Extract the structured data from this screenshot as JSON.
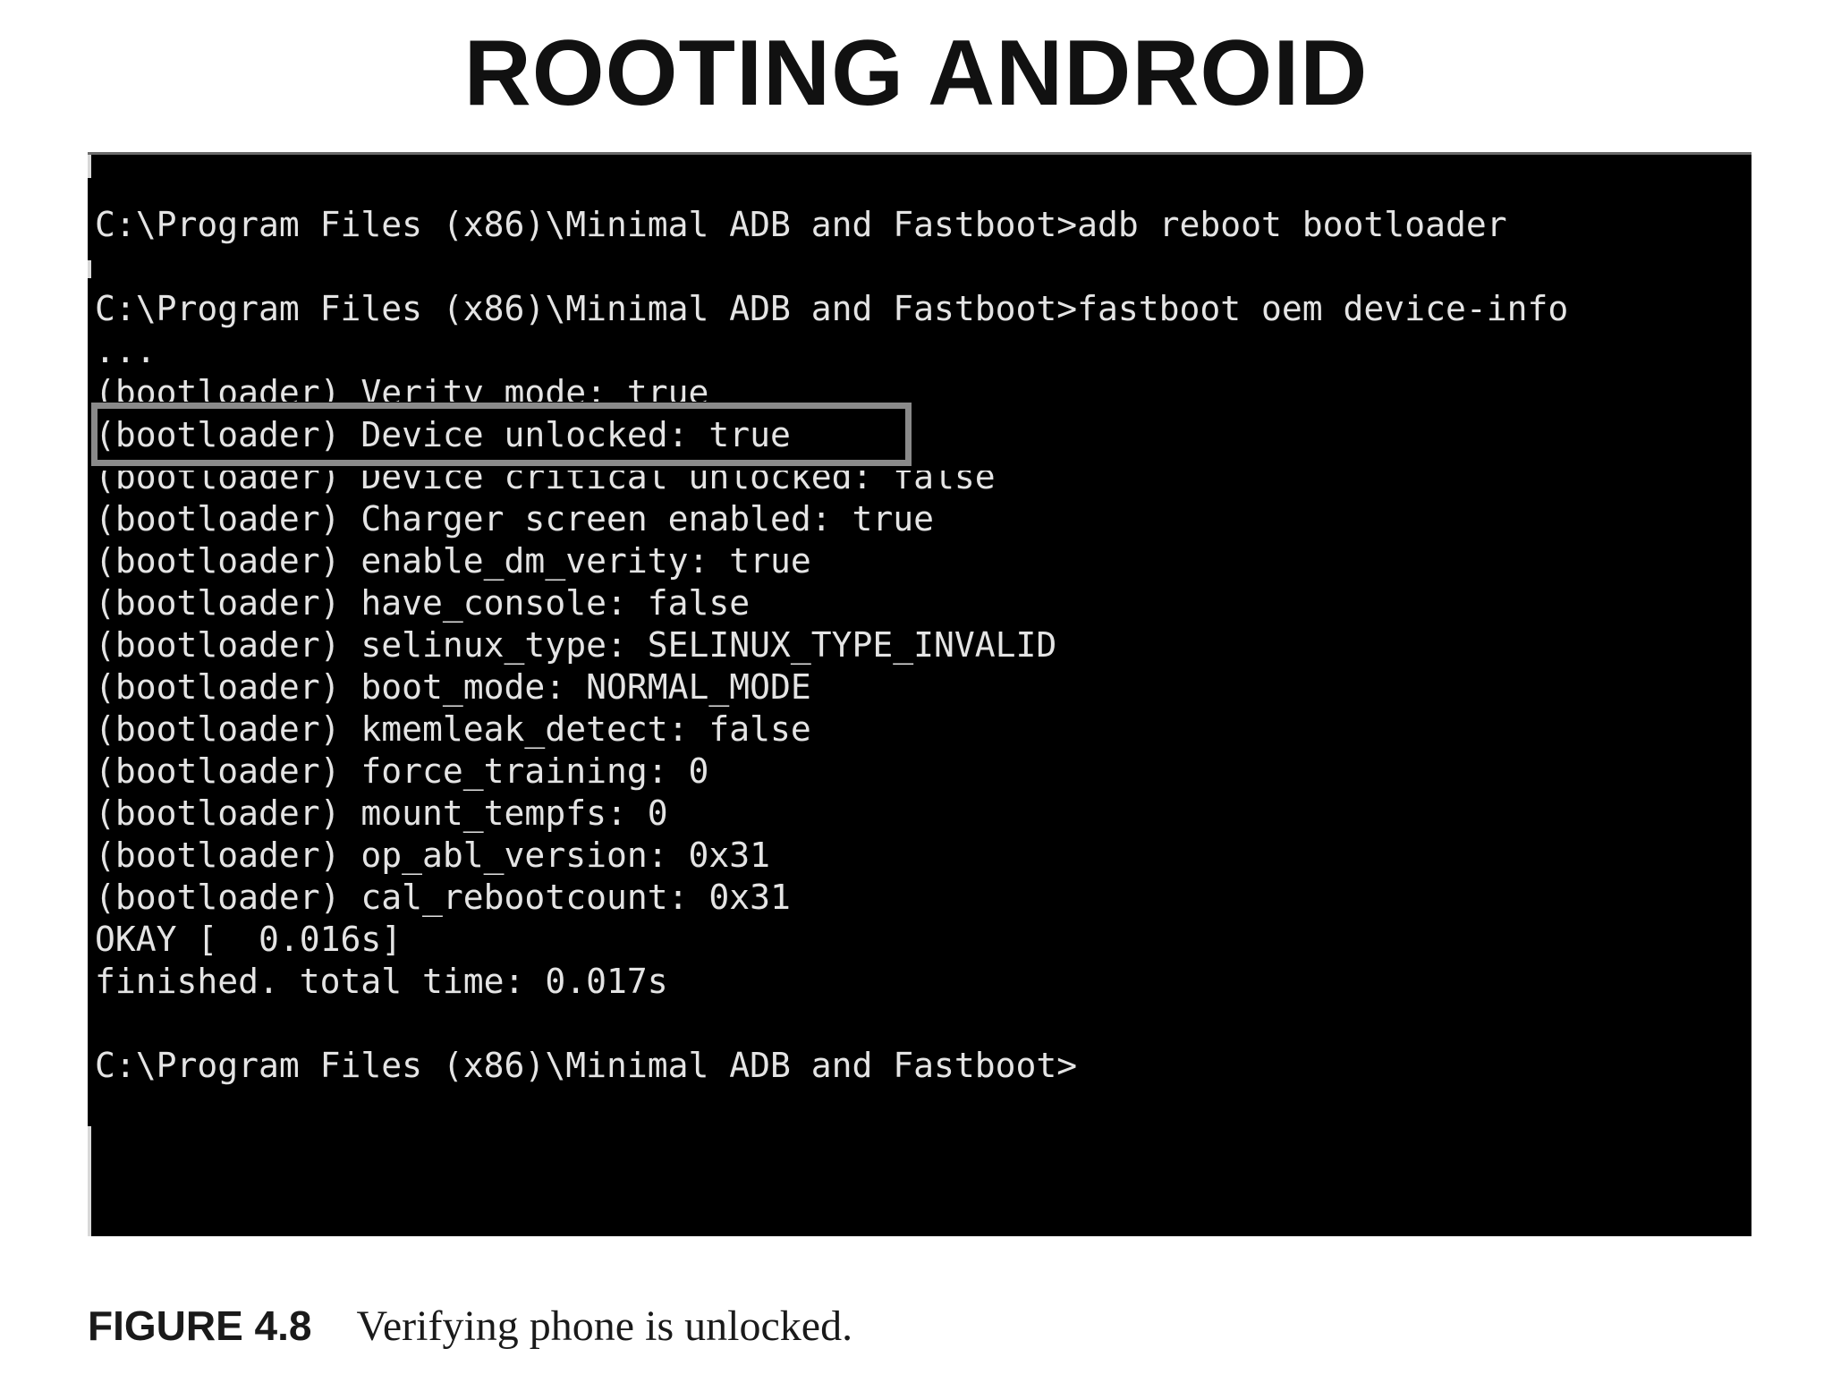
{
  "slide": {
    "title": "ROOTING ANDROID"
  },
  "terminal": {
    "lines": [
      "C:\\Program Files (x86)\\Minimal ADB and Fastboot>adb reboot bootloader",
      "",
      "C:\\Program Files (x86)\\Minimal ADB and Fastboot>fastboot oem device-info",
      "...",
      "(bootloader) Verity mode: true",
      "(bootloader) Device unlocked: true",
      "(bootloader) Device critical unlocked: false",
      "(bootloader) Charger screen enabled: true",
      "(bootloader) enable_dm_verity: true",
      "(bootloader) have_console: false",
      "(bootloader) selinux_type: SELINUX_TYPE_INVALID",
      "(bootloader) boot_mode: NORMAL_MODE",
      "(bootloader) kmemleak_detect: false",
      "(bootloader) force_training: 0",
      "(bootloader) mount_tempfs: 0",
      "(bootloader) op_abl_version: 0x31",
      "(bootloader) cal_rebootcount: 0x31",
      "OKAY [  0.016s]",
      "finished. total time: 0.017s",
      "",
      "C:\\Program Files (x86)\\Minimal ADB and Fastboot>"
    ],
    "highlighted_line": "(bootloader) Device unlocked: true"
  },
  "caption": {
    "label": "FIGURE 4.8",
    "text": "Verifying phone is unlocked."
  }
}
